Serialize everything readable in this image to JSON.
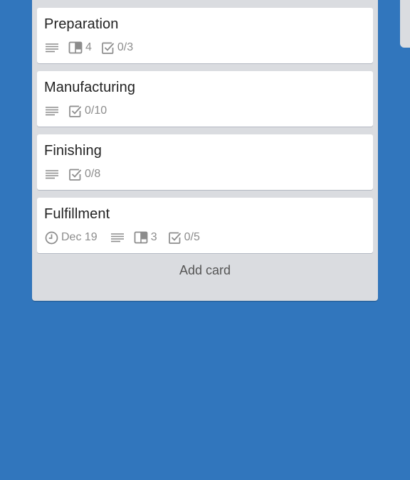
{
  "list": {
    "cards": [
      {
        "title": "Preparation",
        "description_icon": "description-lines-icon",
        "attachments": "4",
        "checklist": "0/3"
      },
      {
        "title": "Manufacturing",
        "description_icon": "description-lines-icon",
        "checklist": "0/10"
      },
      {
        "title": "Finishing",
        "description_icon": "description-lines-icon",
        "checklist": "0/8"
      },
      {
        "title": "Fulfillment",
        "due_date": "Dec 19",
        "description_icon": "description-lines-icon",
        "attachments": "3",
        "checklist": "0/5"
      }
    ],
    "add_card_label": "Add card"
  },
  "colors": {
    "board_background": "#3176bd",
    "list_background": "#dadce0",
    "card_background": "#ffffff",
    "badge_color": "#8c8c8c"
  }
}
